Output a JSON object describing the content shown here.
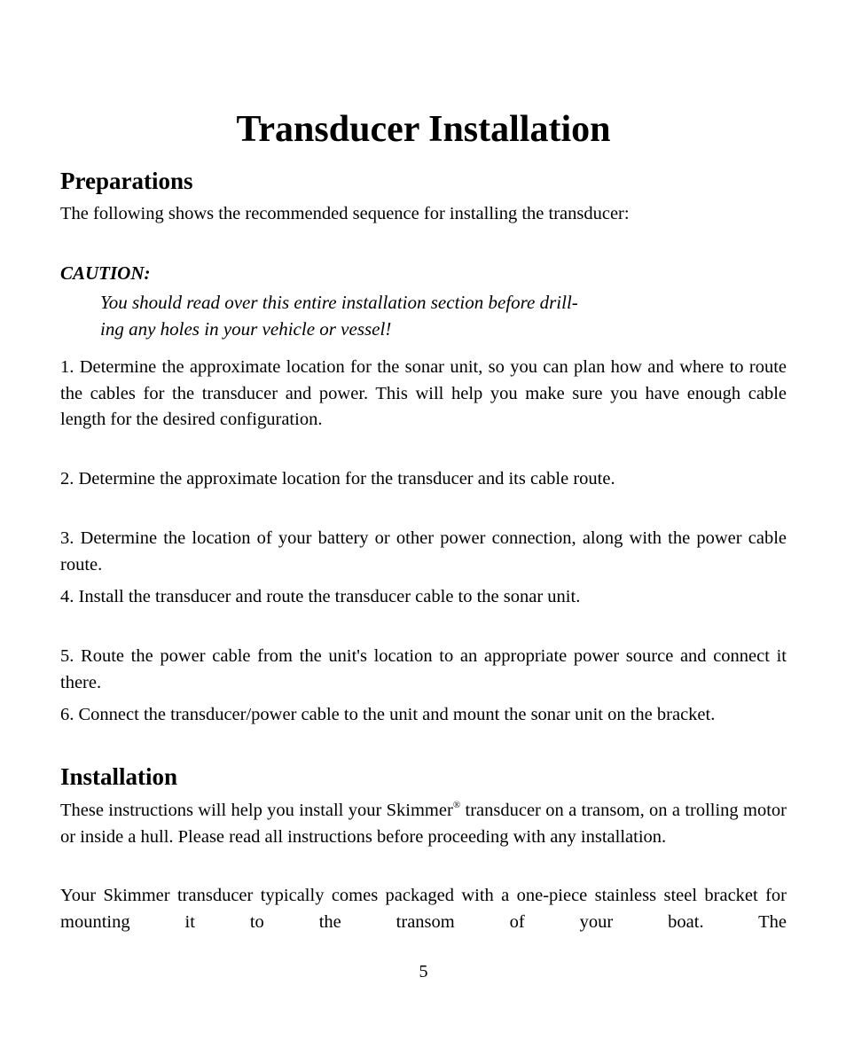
{
  "document": {
    "title": "Transducer Installation",
    "sections": [
      {
        "heading": "Preparations",
        "intro": "The following shows the recommended sequence for installing the transducer:",
        "caution": {
          "label": "CAUTION:",
          "line1": "You should read over this entire installation section before drill-",
          "line2": "ing any holes in your vehicle or vessel!"
        },
        "steps": [
          "1. Determine the approximate location for the sonar unit, so you can plan how and where to route the cables for the transducer and power. This will help you make sure you have enough cable length for the desired configuration.",
          "2. Determine the approximate location for the transducer and its cable route.",
          "3. Determine the location of your battery or other power connection, along with the power cable route.",
          "4. Install the transducer and route the transducer cable to the sonar unit.",
          "5. Route the power cable from the unit's location to an appropriate power source and connect it there.",
          "6. Connect the transducer/power cable to the unit and mount the sonar unit on the bracket."
        ]
      },
      {
        "heading": "Installation",
        "para1_before": "These instructions will help you install your Skimmer",
        "para1_sup": "®",
        "para1_after": " transducer on a transom, on a trolling motor or inside a hull. Please read all instructions before proceeding with any installation.",
        "para2": "Your Skimmer transducer typically comes packaged with a one-piece stainless steel bracket for mounting it to the transom of your boat. The"
      }
    ],
    "page_number": "5"
  }
}
